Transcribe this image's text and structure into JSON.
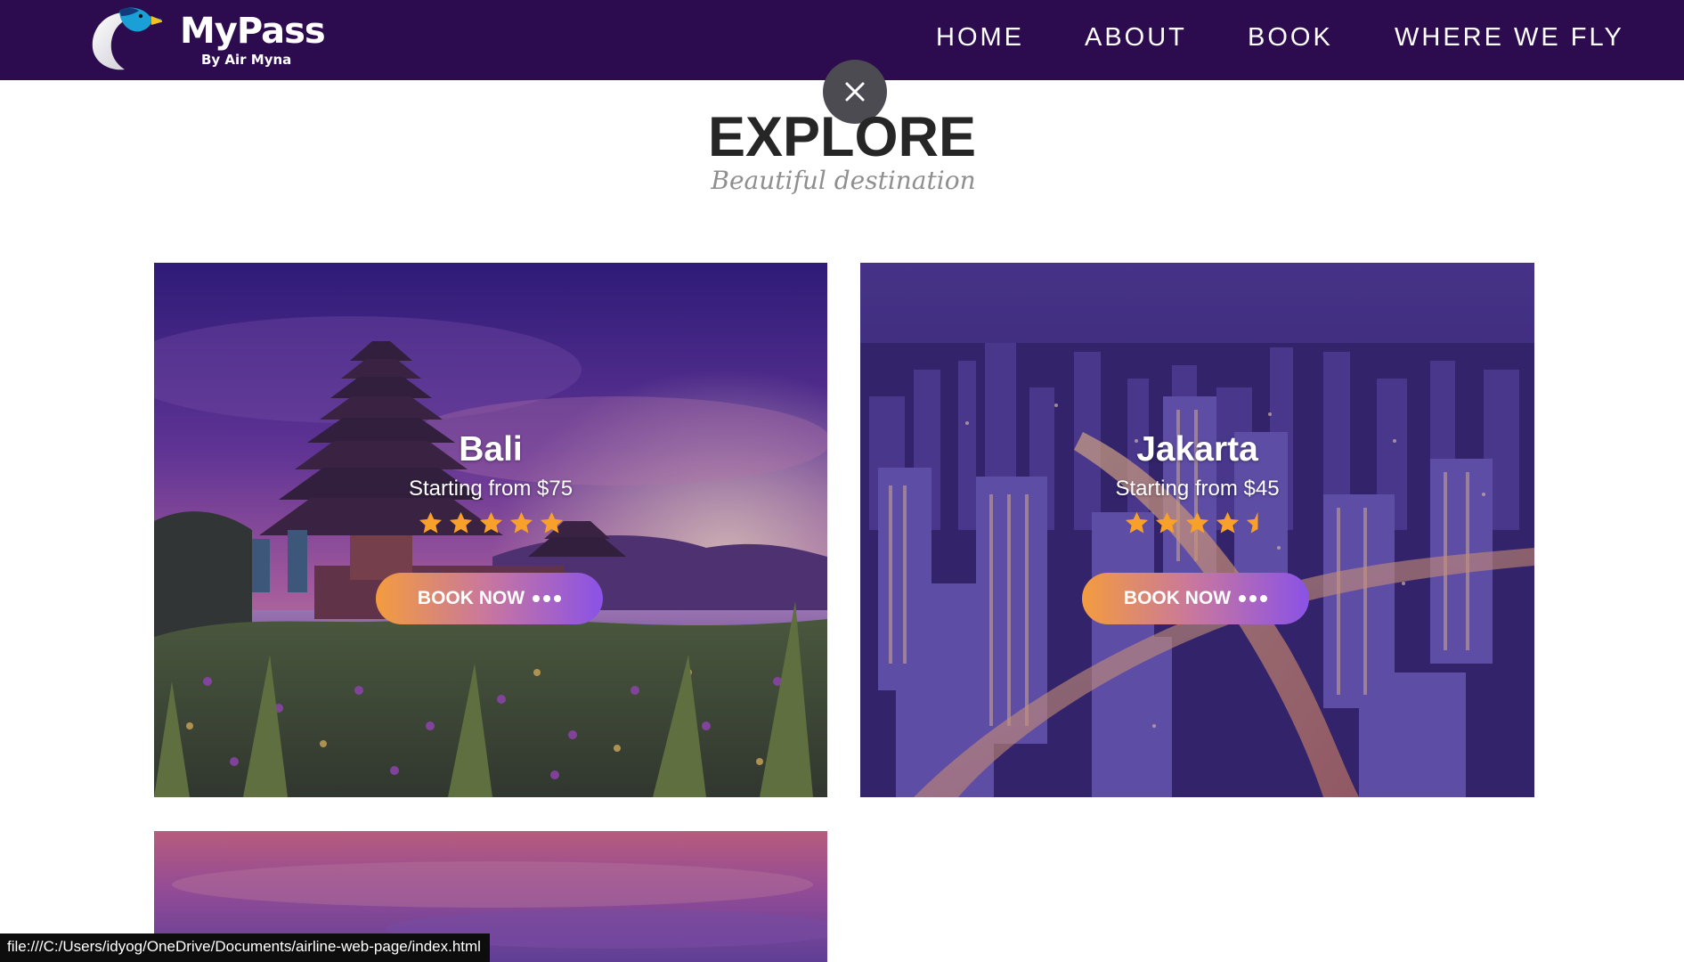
{
  "brand": {
    "title": "MyPass",
    "subtitle": "By Air Myna",
    "logo_icon": "myna-bird-icon"
  },
  "nav": {
    "items": [
      {
        "label": "HOME"
      },
      {
        "label": "ABOUT"
      },
      {
        "label": "BOOK"
      },
      {
        "label": "WHERE WE FLY"
      }
    ]
  },
  "close_icon": "close-icon",
  "section": {
    "title": "EXPLORE",
    "subtitle": "Beautiful destination"
  },
  "destinations": [
    {
      "city": "Bali",
      "price": "Starting from $75",
      "rating": 5,
      "button": "BOOK NOW"
    },
    {
      "city": "Jakarta",
      "price": "Starting from $45",
      "rating": 4.5,
      "button": "BOOK NOW"
    }
  ],
  "status_url": "file:///C:/Users/idyog/OneDrive/Documents/airline-web-page/index.html",
  "colors": {
    "navbar": "#2c0c4e",
    "star": "#f7a02a",
    "button_gradient": [
      "#f39c3f",
      "#8a52e6"
    ]
  }
}
